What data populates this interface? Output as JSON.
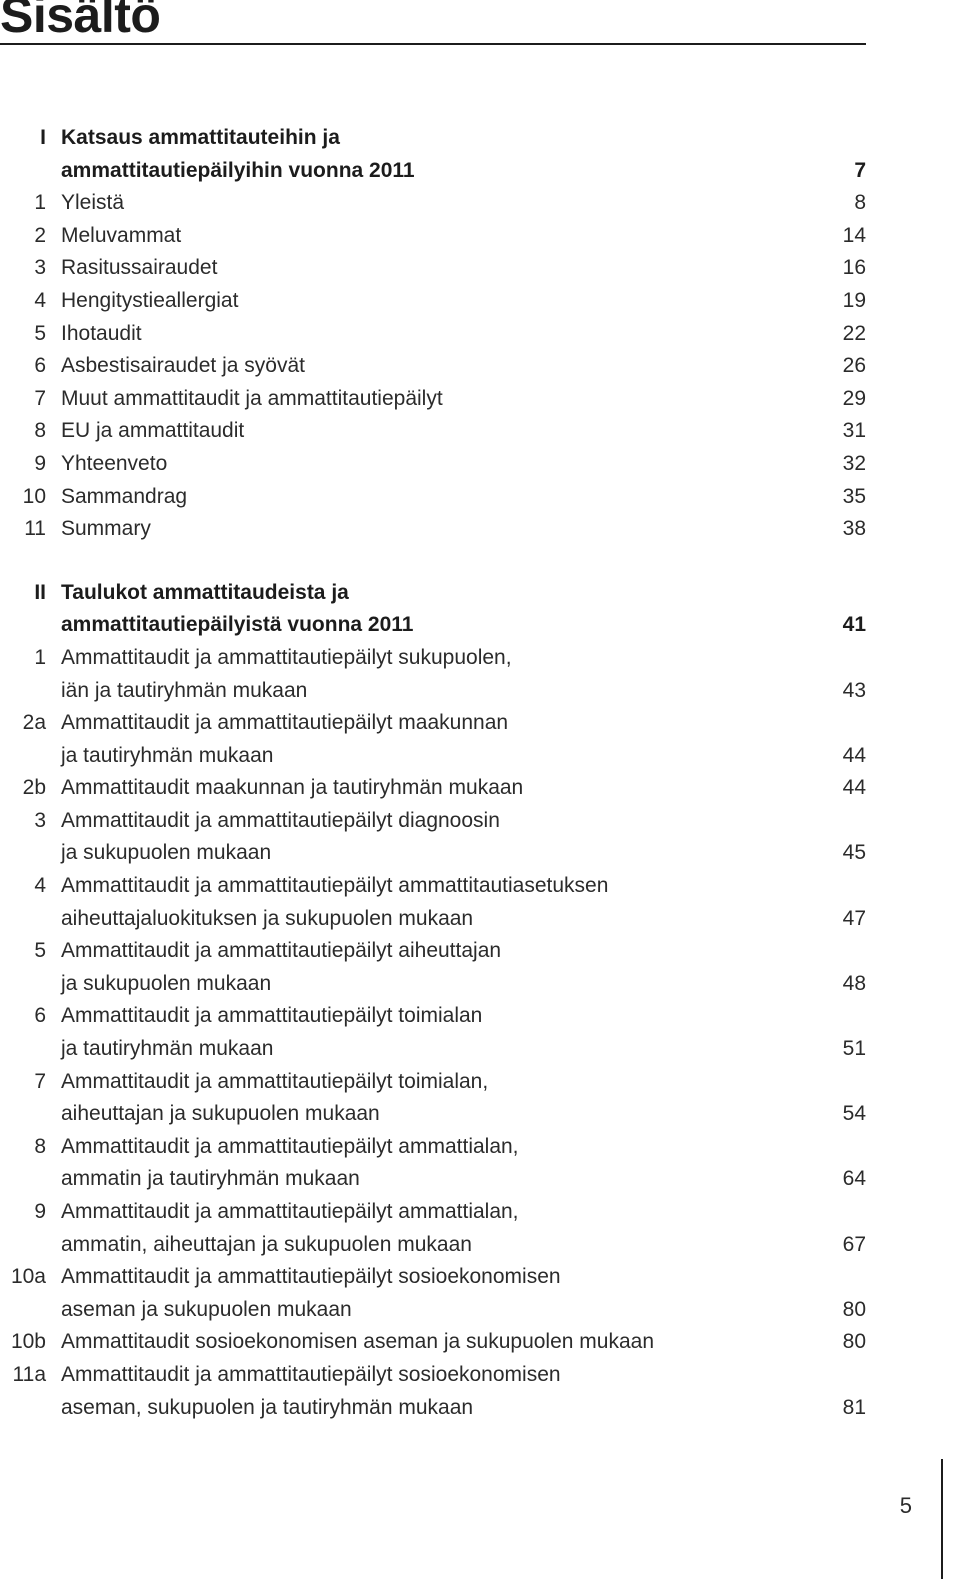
{
  "document": {
    "title": "Sisältö",
    "folio": "5"
  },
  "toc": {
    "sections": [
      {
        "heading": {
          "number": "I",
          "lines": [
            "Katsaus ammattitauteihin ja",
            "ammattitautiepäilyihin vuonna 2011"
          ],
          "page": "7"
        },
        "entries": [
          {
            "number": "1",
            "lines": [
              "Yleistä"
            ],
            "page": "8"
          },
          {
            "number": "2",
            "lines": [
              "Meluvammat"
            ],
            "page": "14"
          },
          {
            "number": "3",
            "lines": [
              "Rasitussairaudet"
            ],
            "page": "16"
          },
          {
            "number": "4",
            "lines": [
              "Hengitystieallergiat"
            ],
            "page": "19"
          },
          {
            "number": "5",
            "lines": [
              "Ihotaudit"
            ],
            "page": "22"
          },
          {
            "number": "6",
            "lines": [
              "Asbestisairaudet ja syövät"
            ],
            "page": "26"
          },
          {
            "number": "7",
            "lines": [
              "Muut ammattitaudit ja ammattitautiepäilyt"
            ],
            "page": "29"
          },
          {
            "number": "8",
            "lines": [
              "EU ja ammattitaudit"
            ],
            "page": "31"
          },
          {
            "number": "9",
            "lines": [
              "Yhteenveto"
            ],
            "page": "32"
          },
          {
            "number": "10",
            "lines": [
              "Sammandrag"
            ],
            "page": "35"
          },
          {
            "number": "11",
            "lines": [
              "Summary"
            ],
            "page": "38"
          }
        ]
      },
      {
        "heading": {
          "number": "II",
          "lines": [
            "Taulukot ammattitaudeista ja",
            "ammattitautiepäilyistä vuonna 2011"
          ],
          "page": "41"
        },
        "entries": [
          {
            "number": "1",
            "lines": [
              "Ammattitaudit ja ammattitautiepäilyt sukupuolen,",
              "iän ja tautiryhmän mukaan"
            ],
            "page": "43"
          },
          {
            "number": "2a",
            "lines": [
              "Ammattitaudit ja ammattitautiepäilyt maakunnan",
              "ja tautiryhmän mukaan"
            ],
            "page": "44"
          },
          {
            "number": "2b",
            "lines": [
              "Ammattitaudit maakunnan ja tautiryhmän mukaan"
            ],
            "page": "44"
          },
          {
            "number": "3",
            "lines": [
              "Ammattitaudit ja ammattitautiepäilyt diagnoosin",
              "ja sukupuolen mukaan"
            ],
            "page": "45"
          },
          {
            "number": "4",
            "lines": [
              "Ammattitaudit ja ammattitautiepäilyt ammattitautiasetuksen",
              "aiheuttajaluokituksen ja sukupuolen mukaan"
            ],
            "page": "47"
          },
          {
            "number": "5",
            "lines": [
              "Ammattitaudit ja ammattitautiepäilyt aiheuttajan",
              "ja sukupuolen mukaan"
            ],
            "page": "48"
          },
          {
            "number": "6",
            "lines": [
              "Ammattitaudit ja ammattitautiepäilyt toimialan",
              "ja tautiryhmän mukaan"
            ],
            "page": "51"
          },
          {
            "number": "7",
            "lines": [
              "Ammattitaudit ja ammattitautiepäilyt toimialan,",
              "aiheuttajan ja sukupuolen mukaan"
            ],
            "page": "54"
          },
          {
            "number": "8",
            "lines": [
              "Ammattitaudit ja ammattitautiepäilyt ammattialan,",
              "ammatin ja tautiryhmän mukaan"
            ],
            "page": "64"
          },
          {
            "number": "9",
            "lines": [
              "Ammattitaudit ja ammattitautiepäilyt ammattialan,",
              "ammatin, aiheuttajan ja sukupuolen mukaan"
            ],
            "page": "67"
          },
          {
            "number": "10a",
            "lines": [
              "Ammattitaudit ja ammattitautiepäilyt sosioekonomisen",
              "aseman ja sukupuolen mukaan"
            ],
            "page": "80"
          },
          {
            "number": "10b",
            "lines": [
              "Ammattitaudit sosioekonomisen aseman ja sukupuolen mukaan"
            ],
            "page": "80"
          },
          {
            "number": "11a",
            "lines": [
              "Ammattitaudit ja ammattitautiepäilyt sosioekonomisen",
              "aseman, sukupuolen ja tautiryhmän mukaan"
            ],
            "page": "81"
          }
        ]
      }
    ]
  }
}
